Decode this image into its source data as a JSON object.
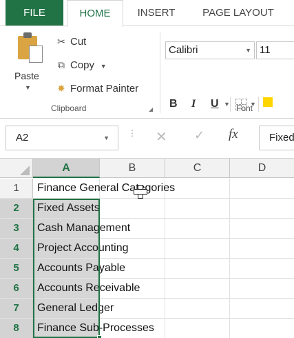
{
  "ribbon_tabs": {
    "file": "FILE",
    "home": "HOME",
    "insert": "INSERT",
    "page_layout": "PAGE LAYOUT"
  },
  "clipboard": {
    "paste": "Paste",
    "cut": "Cut",
    "copy": "Copy",
    "format_painter": "Format Painter",
    "group_label": "Clipboard"
  },
  "font": {
    "name": "Calibri",
    "size": "11",
    "bold": "B",
    "italic": "I",
    "underline": "U",
    "group_label": "Font"
  },
  "formula_bar": {
    "name_box": "A2",
    "fx": "fx",
    "content": "Fixed Assets"
  },
  "grid": {
    "columns": [
      "A",
      "B",
      "C",
      "D"
    ],
    "rows": [
      {
        "num": "1",
        "text": "Finance General Categories"
      },
      {
        "num": "2",
        "text": "Fixed Assets"
      },
      {
        "num": "3",
        "text": "Cash Management"
      },
      {
        "num": "4",
        "text": "Project Accounting"
      },
      {
        "num": "5",
        "text": "Accounts Payable"
      },
      {
        "num": "6",
        "text": "Accounts Receivable"
      },
      {
        "num": "7",
        "text": "General Ledger"
      },
      {
        "num": "8",
        "text": "Finance Sub-Processes"
      }
    ]
  },
  "colors": {
    "accent": "#217346",
    "selection_fill": "#d6d6d6"
  },
  "icons": [
    "cut-icon",
    "copy-icon",
    "format-painter-icon",
    "paste-icon",
    "dropdown-icon",
    "cancel-icon",
    "enter-icon",
    "insert-function-icon",
    "select-all-icon",
    "move-cursor-icon"
  ]
}
